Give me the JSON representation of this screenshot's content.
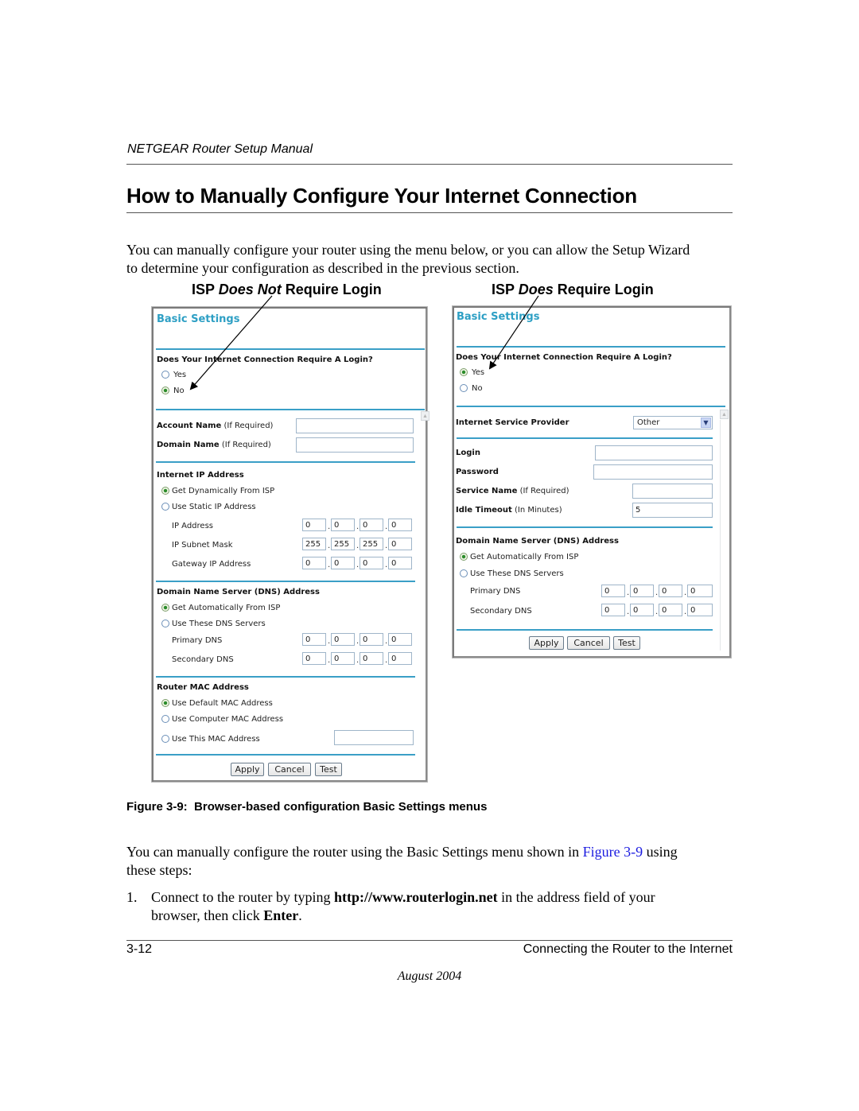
{
  "header": {
    "running_title": "NETGEAR Router Setup Manual"
  },
  "section": {
    "title": "How to Manually Configure Your Internet Connection",
    "intro_line1": "You can manually configure your router using the menu below, or you can allow the Setup Wizard",
    "intro_line2": "to determine your configuration as described in the previous section."
  },
  "captions": {
    "left": {
      "prefix": "ISP ",
      "emph": "Does Not",
      "suffix": " Require Login"
    },
    "right": {
      "prefix": "ISP ",
      "emph": "Does",
      "suffix": " Require Login"
    }
  },
  "left_panel": {
    "title": "Basic Settings",
    "login_question": "Does Your Internet Connection Require A Login?",
    "login_options": [
      {
        "label": "Yes",
        "selected": false
      },
      {
        "label": "No",
        "selected": true
      }
    ],
    "account_name_label": "Account Name",
    "account_name_hint": "(If Required)",
    "account_name_value": "",
    "domain_name_label": "Domain Name",
    "domain_name_hint": "(If Required)",
    "domain_name_value": "",
    "ip_section_title": "Internet IP Address",
    "ip_options": [
      {
        "label": "Get Dynamically From ISP",
        "selected": true
      },
      {
        "label": "Use Static IP Address",
        "selected": false
      }
    ],
    "ip_rows": [
      {
        "label": "IP Address",
        "octets": [
          "0",
          "0",
          "0",
          "0"
        ]
      },
      {
        "label": "IP Subnet Mask",
        "octets": [
          "255",
          "255",
          "255",
          "0"
        ]
      },
      {
        "label": "Gateway IP Address",
        "octets": [
          "0",
          "0",
          "0",
          "0"
        ]
      }
    ],
    "dns_section_title": "Domain Name Server (DNS) Address",
    "dns_options": [
      {
        "label": "Get Automatically From ISP",
        "selected": true
      },
      {
        "label": "Use These DNS Servers",
        "selected": false
      }
    ],
    "dns_rows": [
      {
        "label": "Primary DNS",
        "octets": [
          "0",
          "0",
          "0",
          "0"
        ]
      },
      {
        "label": "Secondary DNS",
        "octets": [
          "0",
          "0",
          "0",
          "0"
        ]
      }
    ],
    "mac_section_title": "Router MAC Address",
    "mac_options": [
      {
        "label": "Use Default MAC Address",
        "selected": true
      },
      {
        "label": "Use Computer MAC Address",
        "selected": false
      },
      {
        "label": "Use This MAC Address",
        "selected": false
      }
    ],
    "mac_value": "",
    "buttons": {
      "apply": "Apply",
      "cancel": "Cancel",
      "test": "Test"
    }
  },
  "right_panel": {
    "title": "Basic Settings",
    "login_question": "Does Your Internet Connection Require A Login?",
    "login_options": [
      {
        "label": "Yes",
        "selected": true
      },
      {
        "label": "No",
        "selected": false
      }
    ],
    "isp_label": "Internet Service Provider",
    "isp_selected": "Other",
    "login_label": "Login",
    "login_value": "",
    "password_label": "Password",
    "password_value": "",
    "service_name_label": "Service Name",
    "service_name_hint": "(If Required)",
    "service_name_value": "",
    "idle_timeout_label": "Idle Timeout",
    "idle_timeout_hint": "(In Minutes)",
    "idle_timeout_value": "5",
    "dns_section_title": "Domain Name Server (DNS) Address",
    "dns_options": [
      {
        "label": "Get Automatically From ISP",
        "selected": true
      },
      {
        "label": "Use These DNS Servers",
        "selected": false
      }
    ],
    "dns_rows": [
      {
        "label": "Primary DNS",
        "octets": [
          "0",
          "0",
          "0",
          "0"
        ]
      },
      {
        "label": "Secondary DNS",
        "octets": [
          "0",
          "0",
          "0",
          "0"
        ]
      }
    ],
    "buttons": {
      "apply": "Apply",
      "cancel": "Cancel",
      "test": "Test"
    }
  },
  "figure": {
    "caption_label": "Figure 3-9:",
    "caption_text": "Browser-based configuration Basic Settings menus"
  },
  "steps_intro": {
    "before_link": "You can manually configure the router using the Basic Settings menu shown in ",
    "link": "Figure 3-9",
    "after_link": " using",
    "line2": "these steps:"
  },
  "steps": [
    {
      "number": "1.",
      "text_before": "Connect to the router by typing ",
      "url": "http://www.routerlogin.net",
      "text_middle": " in the address field of your",
      "line2_before": "browser, then click ",
      "key": "Enter",
      "line2_after": "."
    }
  ],
  "footer": {
    "page_number": "3-12",
    "chapter": "Connecting the Router to the Internet",
    "date": "August 2004"
  },
  "colors": {
    "panel_title": "#2d9fc4",
    "divider": "#3a9fc7",
    "link": "#1a1ae0"
  }
}
